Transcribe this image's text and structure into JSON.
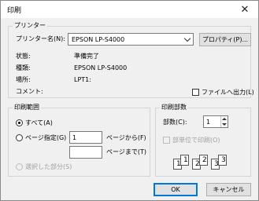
{
  "window": {
    "title": "印刷",
    "close_label": "✕"
  },
  "printer": {
    "group_label": "プリンター",
    "name_label": "プリンター名(N):",
    "name_value": "EPSON LP-S4000",
    "properties_button": "プロパティ(P)...",
    "status_label": "状態:",
    "status_value": "準備完了",
    "type_label": "種類:",
    "type_value": "EPSON LP-S4000",
    "location_label": "場所:",
    "location_value": "LPT1:",
    "comment_label": "コメント:",
    "print_to_file_label": "ファイルへ出力(L)"
  },
  "range": {
    "group_label": "印刷範囲",
    "all_label": "すべて(A)",
    "pages_label": "ページ指定(G)",
    "from_value": "1",
    "from_label": "ページから(F)",
    "to_value": "",
    "to_label": "ページまで(T)",
    "selection_label": "選択した部分(S)"
  },
  "copies": {
    "group_label": "印刷部数",
    "count_label": "部数(C):",
    "count_value": "1",
    "collate_label": "部単位で印刷(O)",
    "collate_pages": [
      "1",
      "1",
      "2",
      "2",
      "3",
      "3"
    ]
  },
  "footer": {
    "ok_label": "OK",
    "cancel_label": "キャンセル"
  },
  "colors": {
    "accent": "#0078d7",
    "dialog_bg": "#f0f0f0"
  }
}
